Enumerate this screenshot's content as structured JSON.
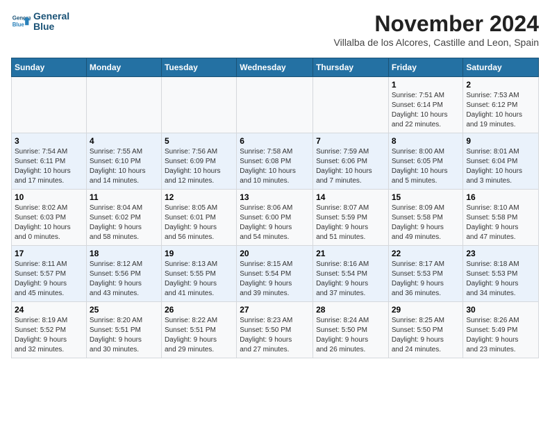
{
  "logo": {
    "line1": "General",
    "line2": "Blue"
  },
  "title": "November 2024",
  "subtitle": "Villalba de los Alcores, Castille and Leon, Spain",
  "days_header": [
    "Sunday",
    "Monday",
    "Tuesday",
    "Wednesday",
    "Thursday",
    "Friday",
    "Saturday"
  ],
  "weeks": [
    [
      {
        "num": "",
        "info": ""
      },
      {
        "num": "",
        "info": ""
      },
      {
        "num": "",
        "info": ""
      },
      {
        "num": "",
        "info": ""
      },
      {
        "num": "",
        "info": ""
      },
      {
        "num": "1",
        "info": "Sunrise: 7:51 AM\nSunset: 6:14 PM\nDaylight: 10 hours\nand 22 minutes."
      },
      {
        "num": "2",
        "info": "Sunrise: 7:53 AM\nSunset: 6:12 PM\nDaylight: 10 hours\nand 19 minutes."
      }
    ],
    [
      {
        "num": "3",
        "info": "Sunrise: 7:54 AM\nSunset: 6:11 PM\nDaylight: 10 hours\nand 17 minutes."
      },
      {
        "num": "4",
        "info": "Sunrise: 7:55 AM\nSunset: 6:10 PM\nDaylight: 10 hours\nand 14 minutes."
      },
      {
        "num": "5",
        "info": "Sunrise: 7:56 AM\nSunset: 6:09 PM\nDaylight: 10 hours\nand 12 minutes."
      },
      {
        "num": "6",
        "info": "Sunrise: 7:58 AM\nSunset: 6:08 PM\nDaylight: 10 hours\nand 10 minutes."
      },
      {
        "num": "7",
        "info": "Sunrise: 7:59 AM\nSunset: 6:06 PM\nDaylight: 10 hours\nand 7 minutes."
      },
      {
        "num": "8",
        "info": "Sunrise: 8:00 AM\nSunset: 6:05 PM\nDaylight: 10 hours\nand 5 minutes."
      },
      {
        "num": "9",
        "info": "Sunrise: 8:01 AM\nSunset: 6:04 PM\nDaylight: 10 hours\nand 3 minutes."
      }
    ],
    [
      {
        "num": "10",
        "info": "Sunrise: 8:02 AM\nSunset: 6:03 PM\nDaylight: 10 hours\nand 0 minutes."
      },
      {
        "num": "11",
        "info": "Sunrise: 8:04 AM\nSunset: 6:02 PM\nDaylight: 9 hours\nand 58 minutes."
      },
      {
        "num": "12",
        "info": "Sunrise: 8:05 AM\nSunset: 6:01 PM\nDaylight: 9 hours\nand 56 minutes."
      },
      {
        "num": "13",
        "info": "Sunrise: 8:06 AM\nSunset: 6:00 PM\nDaylight: 9 hours\nand 54 minutes."
      },
      {
        "num": "14",
        "info": "Sunrise: 8:07 AM\nSunset: 5:59 PM\nDaylight: 9 hours\nand 51 minutes."
      },
      {
        "num": "15",
        "info": "Sunrise: 8:09 AM\nSunset: 5:58 PM\nDaylight: 9 hours\nand 49 minutes."
      },
      {
        "num": "16",
        "info": "Sunrise: 8:10 AM\nSunset: 5:58 PM\nDaylight: 9 hours\nand 47 minutes."
      }
    ],
    [
      {
        "num": "17",
        "info": "Sunrise: 8:11 AM\nSunset: 5:57 PM\nDaylight: 9 hours\nand 45 minutes."
      },
      {
        "num": "18",
        "info": "Sunrise: 8:12 AM\nSunset: 5:56 PM\nDaylight: 9 hours\nand 43 minutes."
      },
      {
        "num": "19",
        "info": "Sunrise: 8:13 AM\nSunset: 5:55 PM\nDaylight: 9 hours\nand 41 minutes."
      },
      {
        "num": "20",
        "info": "Sunrise: 8:15 AM\nSunset: 5:54 PM\nDaylight: 9 hours\nand 39 minutes."
      },
      {
        "num": "21",
        "info": "Sunrise: 8:16 AM\nSunset: 5:54 PM\nDaylight: 9 hours\nand 37 minutes."
      },
      {
        "num": "22",
        "info": "Sunrise: 8:17 AM\nSunset: 5:53 PM\nDaylight: 9 hours\nand 36 minutes."
      },
      {
        "num": "23",
        "info": "Sunrise: 8:18 AM\nSunset: 5:53 PM\nDaylight: 9 hours\nand 34 minutes."
      }
    ],
    [
      {
        "num": "24",
        "info": "Sunrise: 8:19 AM\nSunset: 5:52 PM\nDaylight: 9 hours\nand 32 minutes."
      },
      {
        "num": "25",
        "info": "Sunrise: 8:20 AM\nSunset: 5:51 PM\nDaylight: 9 hours\nand 30 minutes."
      },
      {
        "num": "26",
        "info": "Sunrise: 8:22 AM\nSunset: 5:51 PM\nDaylight: 9 hours\nand 29 minutes."
      },
      {
        "num": "27",
        "info": "Sunrise: 8:23 AM\nSunset: 5:50 PM\nDaylight: 9 hours\nand 27 minutes."
      },
      {
        "num": "28",
        "info": "Sunrise: 8:24 AM\nSunset: 5:50 PM\nDaylight: 9 hours\nand 26 minutes."
      },
      {
        "num": "29",
        "info": "Sunrise: 8:25 AM\nSunset: 5:50 PM\nDaylight: 9 hours\nand 24 minutes."
      },
      {
        "num": "30",
        "info": "Sunrise: 8:26 AM\nSunset: 5:49 PM\nDaylight: 9 hours\nand 23 minutes."
      }
    ]
  ]
}
